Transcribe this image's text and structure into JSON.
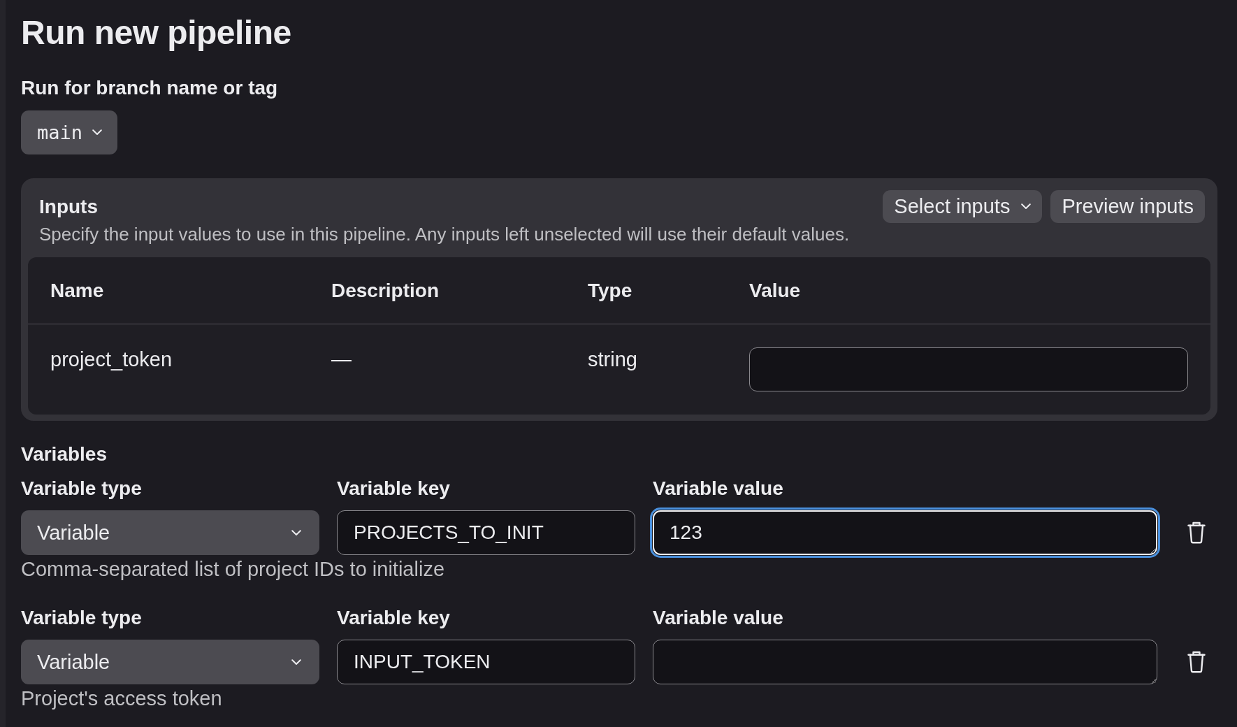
{
  "page": {
    "title": "Run new pipeline"
  },
  "branch": {
    "label": "Run for branch name or tag",
    "value": "main"
  },
  "inputs": {
    "title": "Inputs",
    "description": "Specify the input values to use in this pipeline. Any inputs left unselected will use their default values.",
    "buttons": [
      {
        "label": "Select inputs",
        "kind": "dropdown"
      },
      {
        "label": "Preview inputs",
        "kind": "button"
      }
    ],
    "table": {
      "columns": [
        "Name",
        "Description",
        "Type",
        "Value"
      ],
      "rows": [
        {
          "name": "project_token",
          "description": "—",
          "type": "string"
        }
      ]
    }
  },
  "variables": {
    "title": "Variables",
    "rows": [
      {
        "type_label": "Variable type",
        "type": "Variable",
        "key_label": "Variable key",
        "key": "PROJECTS_TO_INIT",
        "value_label": "Variable value",
        "value": "123",
        "focused": true,
        "help": "Comma-separated list of project IDs to initialize"
      },
      {
        "type_label": "Variable type",
        "type": "Variable",
        "key_label": "Variable key",
        "key": "INPUT_TOKEN",
        "value_label": "Variable value",
        "focused": false,
        "help": "Project's access token"
      }
    ]
  }
}
